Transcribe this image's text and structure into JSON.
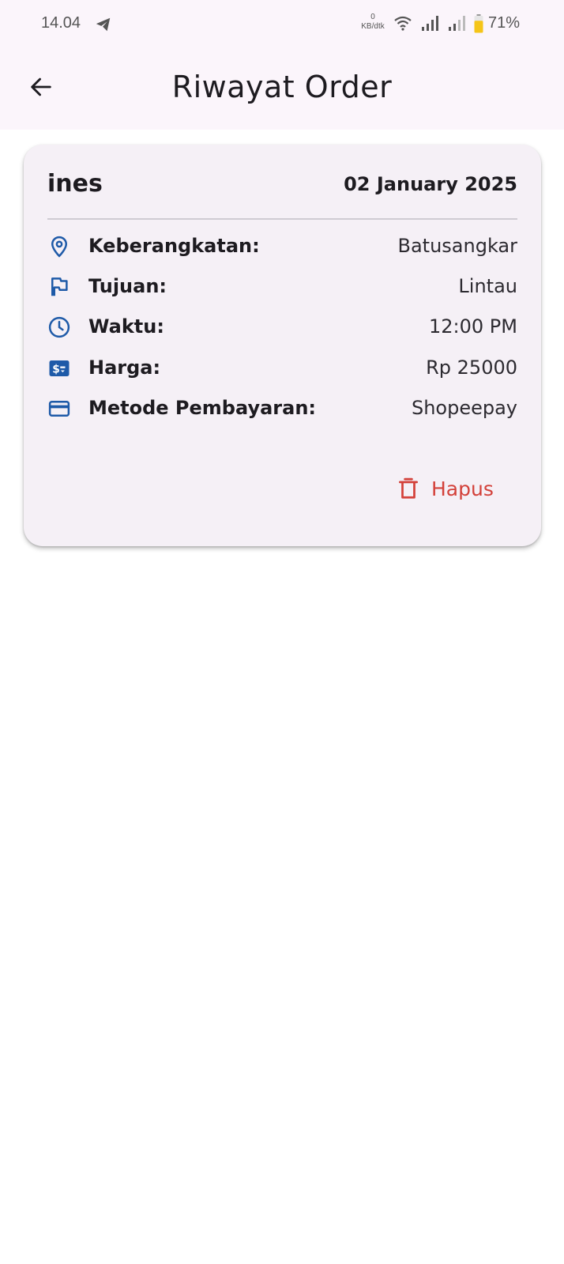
{
  "status_bar": {
    "time": "14.04",
    "net_speed_value": "0",
    "net_speed_unit": "KB/dtk",
    "battery_percent": "71%",
    "battery_level": 0.71,
    "battery_color": "#f5c518"
  },
  "app_bar": {
    "title": "Riwayat Order",
    "back_icon": "arrow-left-icon",
    "background": "#fbf5fb"
  },
  "order": {
    "name": "ines",
    "date": "02 January 2025",
    "details": [
      {
        "icon": "location-pin-icon",
        "label": "Keberangkatan:",
        "value": "Batusangkar"
      },
      {
        "icon": "flag-icon",
        "label": "Tujuan:",
        "value": "Lintau"
      },
      {
        "icon": "clock-icon",
        "label": "Waktu:",
        "value": "12:00 PM"
      },
      {
        "icon": "price-tag-icon",
        "label": "Harga:",
        "value": "Rp 25000"
      },
      {
        "icon": "credit-card-icon",
        "label": "Metode Pembayaran:",
        "value": "Shopeepay"
      }
    ],
    "delete_label": "Hapus",
    "delete_icon": "trash-icon"
  },
  "colors": {
    "accent_blue": "#1e5aa8",
    "delete_red": "#d3413a",
    "card_background": "#f5f0f6"
  }
}
